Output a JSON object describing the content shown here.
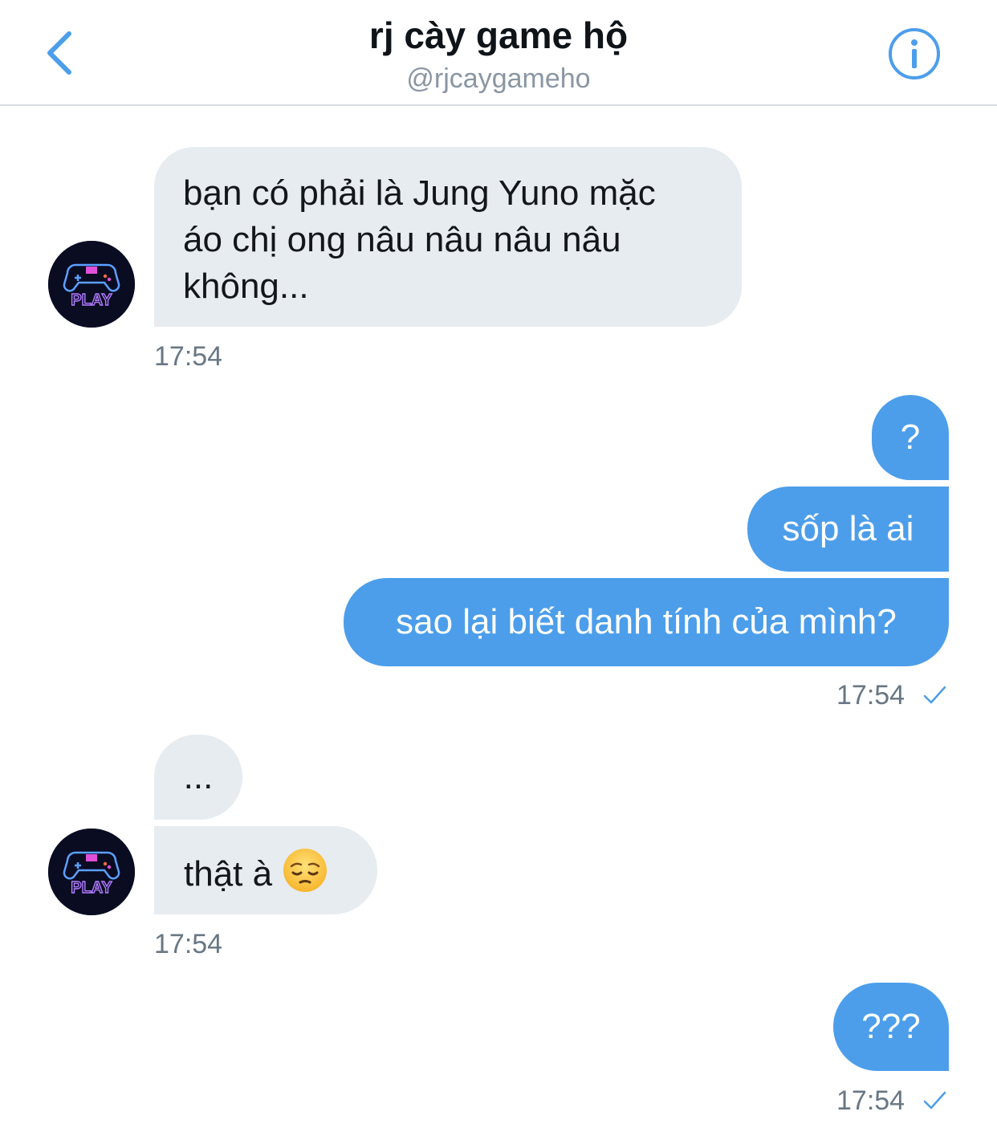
{
  "header": {
    "title": "rj cày game hộ",
    "handle": "@rjcaygameho"
  },
  "avatar": {
    "text": "PLAY"
  },
  "messages": {
    "m1": {
      "text": "bạn có phải là Jung Yuno mặc áo chị ong nâu nâu nâu nâu không...",
      "line1": "bạn có phải là Jung Yuno mặc",
      "line2": "áo chị ong nâu nâu nâu nâu",
      "line3": "không...",
      "time": "17:54"
    },
    "m2": {
      "text": "?"
    },
    "m3": {
      "text": "sốp là ai"
    },
    "m4": {
      "text": "sao lại biết danh tính của mình?",
      "time": "17:54"
    },
    "m5": {
      "text": "..."
    },
    "m6": {
      "text": "thật à",
      "emoji": "pensive-face",
      "time": "17:54"
    },
    "m7": {
      "text": "???",
      "time": "17:54"
    }
  },
  "colors": {
    "accent": "#4c9eea",
    "incoming_bubble": "#e6ecf0",
    "timestamp": "#697784"
  }
}
